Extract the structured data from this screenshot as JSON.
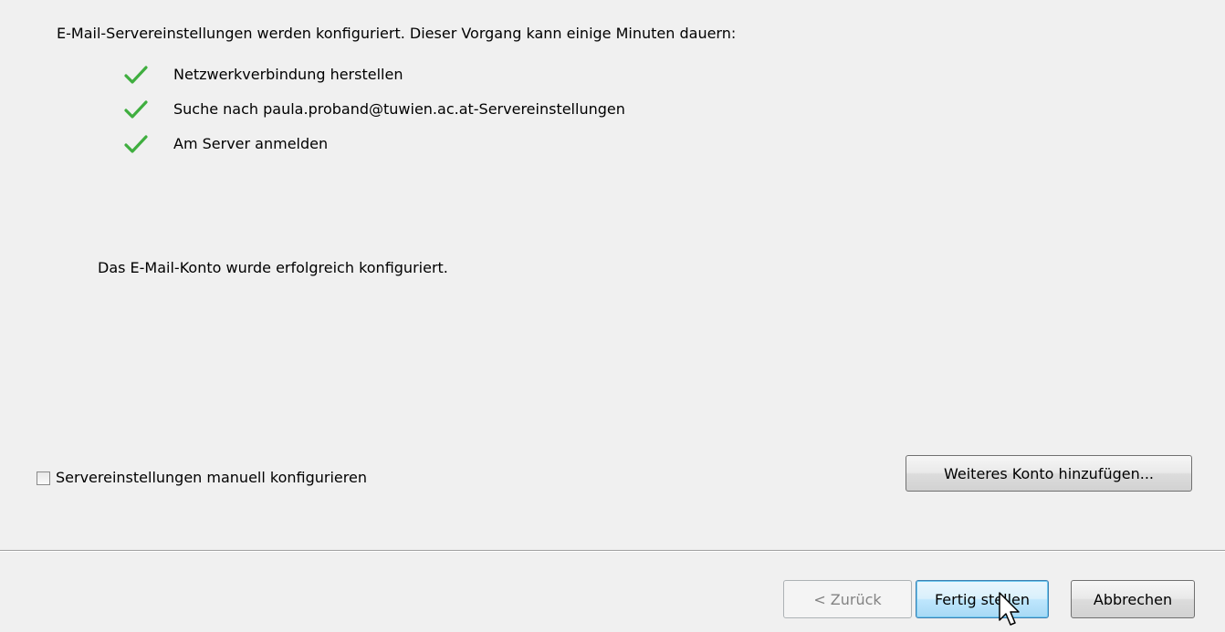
{
  "intro_text": "E-Mail-Servereinstellungen werden konfiguriert. Dieser Vorgang kann einige Minuten dauern:",
  "steps": [
    {
      "icon": "checkmark-icon",
      "label": "Netzwerkverbindung herstellen",
      "status": "done"
    },
    {
      "icon": "checkmark-icon",
      "label": "Suche nach paula.proband@tuwien.ac.at-Servereinstellungen",
      "status": "done"
    },
    {
      "icon": "checkmark-icon",
      "label": "Am Server anmelden",
      "status": "done"
    }
  ],
  "success_text": "Das E-Mail-Konto wurde erfolgreich konfiguriert.",
  "manual_config": {
    "label": "Servereinstellungen manuell konfigurieren",
    "checked": false
  },
  "add_account_button": "Weiteres Konto hinzufügen...",
  "footer": {
    "back_button": "< Zurück",
    "finish_button": "Fertig stellen",
    "cancel_button": "Abbrechen"
  },
  "colors": {
    "background": "#f0f0f0",
    "checkmark": "#3fae3f",
    "disabled_text": "#838383",
    "focus_border": "#3c7fb1"
  }
}
